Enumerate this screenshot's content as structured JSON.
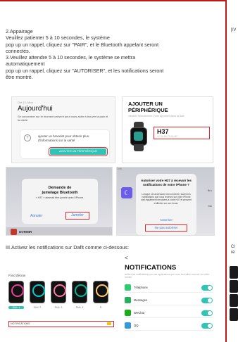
{
  "steps": {
    "lines": [
      "2.Appairage",
      "Veuillez patienter 5 à 10 secondes, le système",
      "pop up un rappel, cliquez sur \"PAIR\", et le Bluetooth appelant seront",
      "connectés.",
      "3.Veuillez attendre 5 à 10 secondes, le système se mettra",
      "automatiquement",
      "pop up un rappel, cliquez sur \"AUTORISER\", et les notifications seront",
      "être montré."
    ]
  },
  "shot1": {
    "small": "Oct 12, Mon",
    "title": "Aujourd'hui",
    "desc": "Se concentrer sur le moment présent peut vous aider à trouver la paix et la clarté.",
    "card_text": "ajouter un bracelet pour obtenir plus d'informations sur la santé",
    "button": "AJOUTER UN PÉRIPHÉRIQUE"
  },
  "shot2": {
    "title_line1": "AJOUTER UN",
    "title_line2": "PÉRIPHÉRIQUE",
    "sub": "Veuillez sélectionner votre appareil dans la liste",
    "model": "H37",
    "model_id": "12:34:56:78:9A:BC"
  },
  "shot3": {
    "dialog_title_line1": "Demande de",
    "dialog_title_line2": "jumelage Bluetooth",
    "dialog_body": "« H37 » aimerait être jumelé avec l'iPhone.",
    "cancel": "Annuler",
    "join": "Jumeler",
    "bottom_label": "DORMIR"
  },
  "shot4": {
    "topbar": "Dafit",
    "dialog_title": "Autoriser votre H37 à recevoir les notifications de votre iPhone ?",
    "dialog_body": "Lorsque cet accessoire est connecté, toutes les notifications que vous recevez sur votre iPhone sont également envoyées à votre H37 et peuvent s'afficher sur son écran.",
    "allow": "Autoriser",
    "deny": "Ne pas autoriser",
    "side_top": "Bru",
    "side_mid": "Stc"
  },
  "section3": {
    "title": "III.Activez les notifications sur Dafit comme ci-dessous:"
  },
  "shot5": {
    "label": "Fond d'écran",
    "dials": [
      "DIAL 1",
      "DIAL 2",
      "DIAL 3",
      "DIAL 4",
      "D"
    ],
    "notif_label": "NOTIFICATIONS"
  },
  "shot6": {
    "back": "<",
    "title": "NOTIFICATIONS",
    "sub": "Activer les notifications pour les applications que vous souhaitez recevoir sur votre montre",
    "rows": [
      {
        "name": "Téléphone",
        "color": "#2ecc71"
      },
      {
        "name": "Messages",
        "color": "#27ae60"
      },
      {
        "name": "WeChat",
        "color": "#1aad19"
      },
      {
        "name": "QQ",
        "color": "#3498db"
      }
    ]
  },
  "right_page": {
    "top_text": "[\\V",
    "mid_text_1": "Cl",
    "mid_text_2": "ré"
  },
  "colors": {
    "accent": "#2ec4b6",
    "highlight": "#e0282e",
    "page_border": "#c01818"
  }
}
